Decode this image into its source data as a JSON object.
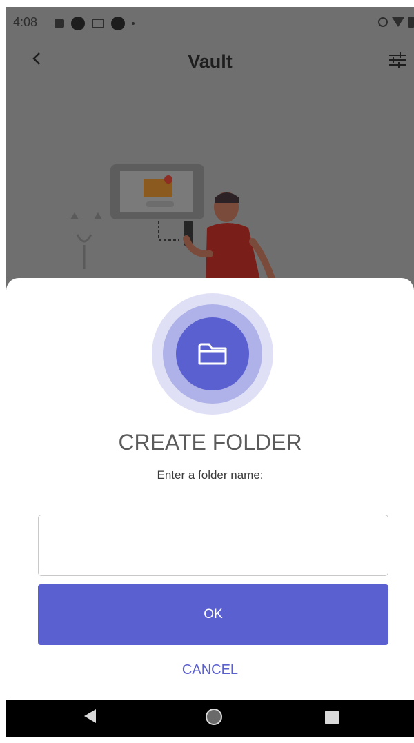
{
  "statusbar": {
    "time": "4:08"
  },
  "appbar": {
    "title": "Vault"
  },
  "dialog": {
    "title": "CREATE FOLDER",
    "subtitle": "Enter a folder name:",
    "input_value": "",
    "input_placeholder": "",
    "ok_label": "OK",
    "cancel_label": "CANCEL"
  },
  "colors": {
    "accent": "#5a60cf",
    "scrim_background": "#6f6f6f",
    "title_text": "#5b5b5b"
  },
  "icons": [
    "back-arrow-icon",
    "filter-icon",
    "folder-icon",
    "nav-back-icon",
    "nav-home-icon",
    "nav-recent-icon"
  ]
}
